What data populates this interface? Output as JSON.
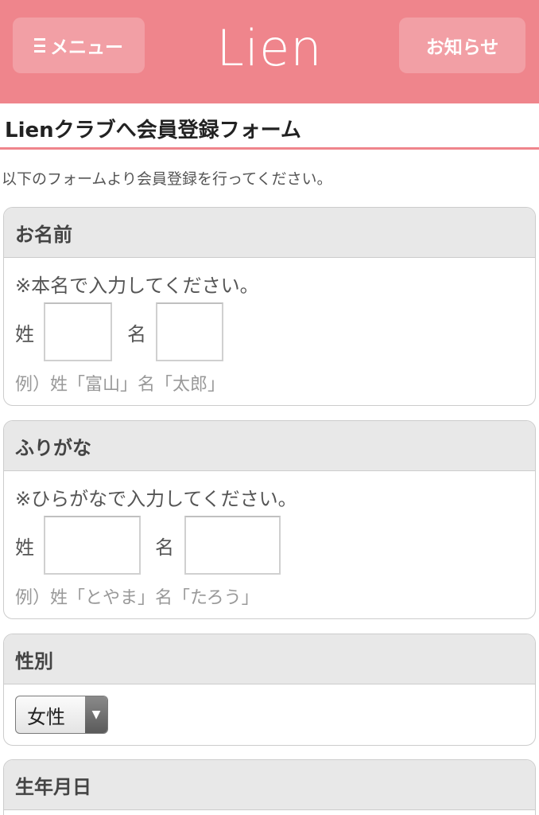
{
  "header": {
    "menu_label": "メニュー",
    "logo_text": "Lien",
    "info_label": "お知らせ",
    "bg_color": "#ef858c"
  },
  "page": {
    "title": "Lienクラブへ会員登録フォーム",
    "intro": "以下のフォームより会員登録を行ってください。"
  },
  "form": {
    "name": {
      "heading": "お名前",
      "note": "※本名で入力してください。",
      "last_label": "姓",
      "first_label": "名",
      "example": "例）姓「富山」名「太郎」"
    },
    "furigana": {
      "heading": "ふりがな",
      "note": "※ひらがなで入力してください。",
      "last_label": "姓",
      "first_label": "名",
      "example": "例）姓「とやま」名「たろう」"
    },
    "gender": {
      "heading": "性別",
      "selected": "女性",
      "arrow_icon": "triangle-down"
    },
    "birthday": {
      "heading": "生年月日"
    }
  }
}
